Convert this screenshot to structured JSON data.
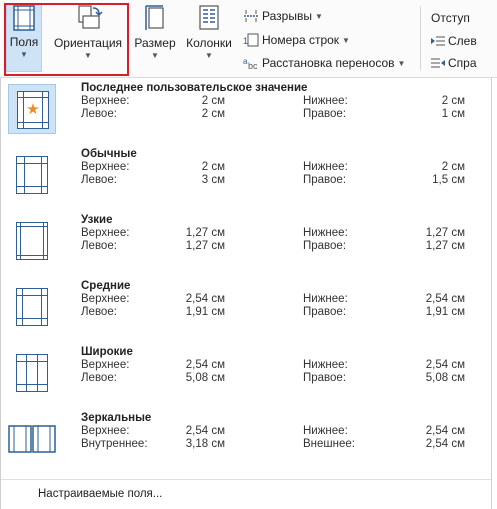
{
  "ribbon": {
    "margins_label": "Поля",
    "orientation_label": "Ориентация",
    "size_label": "Размер",
    "columns_label": "Колонки",
    "breaks_label": "Разрывы",
    "line_numbers_label": "Номера строк",
    "hyphenation_label": "Расстановка переносов",
    "indent_title": "Отступ",
    "indent_left": "Слев",
    "indent_right": "Спра"
  },
  "presets": [
    {
      "name": "Последнее пользовательское значение",
      "row1": {
        "label_a": "Верхнее:",
        "value_a": "2 см",
        "label_b": "Нижнее:",
        "value_b": "2 см"
      },
      "row2": {
        "label_a": "Левое:",
        "value_a": "2 см",
        "label_b": "Правое:",
        "value_b": "1 см"
      },
      "icon": "custom-margins-star-icon",
      "selected": true
    },
    {
      "name": "Обычные",
      "row1": {
        "label_a": "Верхнее:",
        "value_a": "2 см",
        "label_b": "Нижнее:",
        "value_b": "2 см"
      },
      "row2": {
        "label_a": "Левое:",
        "value_a": "3 см",
        "label_b": "Правое:",
        "value_b": "1,5 см"
      },
      "icon": "normal-margins-icon"
    },
    {
      "name": "Узкие",
      "row1": {
        "label_a": "Верхнее:",
        "value_a": "1,27 см",
        "label_b": "Нижнее:",
        "value_b": "1,27 см"
      },
      "row2": {
        "label_a": "Левое:",
        "value_a": "1,27 см",
        "label_b": "Правое:",
        "value_b": "1,27 см"
      },
      "icon": "narrow-margins-icon"
    },
    {
      "name": "Средние",
      "row1": {
        "label_a": "Верхнее:",
        "value_a": "2,54 см",
        "label_b": "Нижнее:",
        "value_b": "2,54 см"
      },
      "row2": {
        "label_a": "Левое:",
        "value_a": "1,91 см",
        "label_b": "Правое:",
        "value_b": "1,91 см"
      },
      "icon": "moderate-margins-icon"
    },
    {
      "name": "Широкие",
      "row1": {
        "label_a": "Верхнее:",
        "value_a": "2,54 см",
        "label_b": "Нижнее:",
        "value_b": "2,54 см"
      },
      "row2": {
        "label_a": "Левое:",
        "value_a": "5,08 см",
        "label_b": "Правое:",
        "value_b": "5,08 см"
      },
      "icon": "wide-margins-icon"
    },
    {
      "name": "Зеркальные",
      "row1": {
        "label_a": "Верхнее:",
        "value_a": "2,54 см",
        "label_b": "Нижнее:",
        "value_b": "2,54 см"
      },
      "row2": {
        "label_a": "Внутреннее:",
        "value_a": "3,18 см",
        "label_b": "Внешнее:",
        "value_b": "2,54 см"
      },
      "icon": "mirrored-margins-icon"
    }
  ],
  "footer": {
    "custom_margins_label": "Настраиваемые поля..."
  },
  "colors": {
    "accent": "#2f5f94",
    "selection": "#cfe3f7",
    "highlight_border": "#d61f2a",
    "star": "#f08a24"
  }
}
